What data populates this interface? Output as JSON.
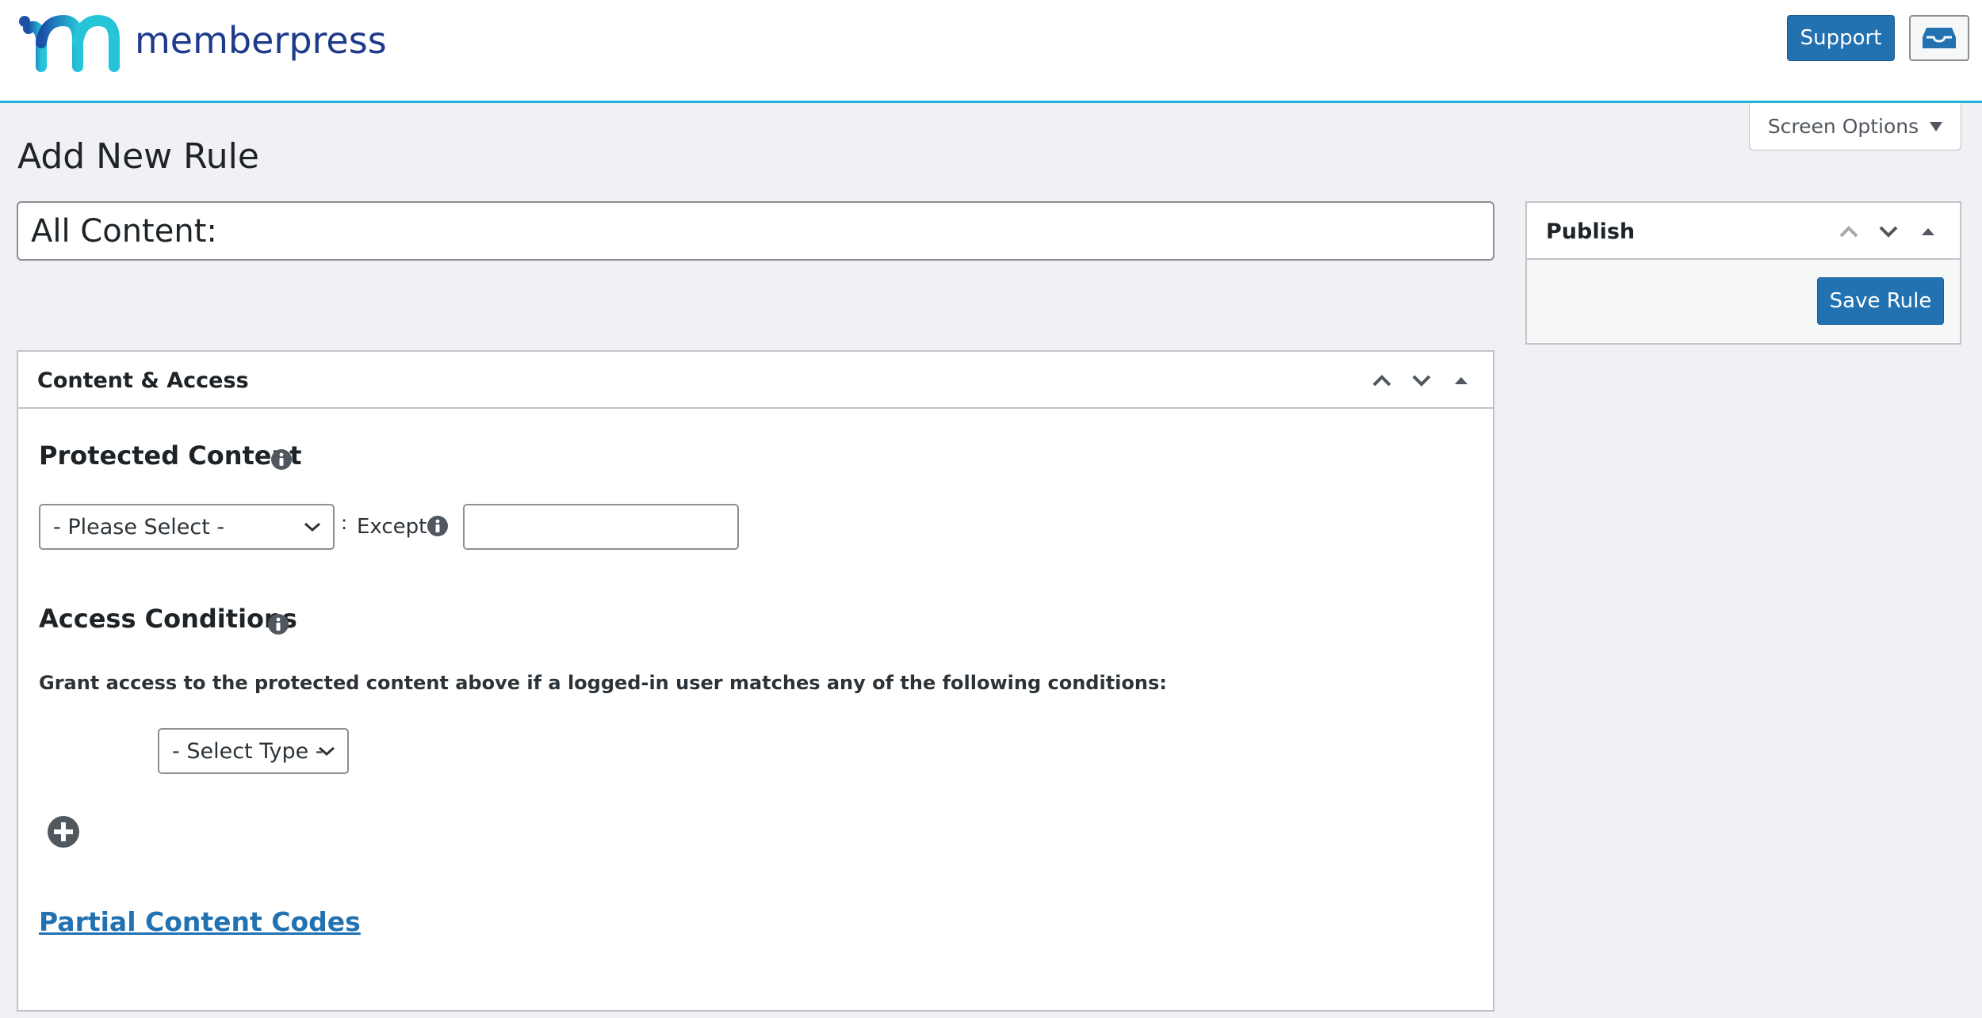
{
  "header": {
    "brand": "memberpress",
    "support_label": "Support"
  },
  "screen_options": {
    "label": "Screen Options"
  },
  "page": {
    "title": "Add New Rule",
    "rule_title_value": "All Content:"
  },
  "publish": {
    "title": "Publish",
    "save_label": "Save Rule"
  },
  "content_access": {
    "title": "Content & Access",
    "protected_content_heading": "Protected Content",
    "protected_select_value": "- Please Select -",
    "colon": ":",
    "except_label": "Except",
    "except_value": "",
    "access_conditions_heading": "Access Conditions",
    "grant_text": "Grant access to the protected content above if a logged-in user matches any of the following conditions:",
    "select_type_value": "- Select Type -",
    "partial_link": "Partial Content Codes"
  },
  "colors": {
    "accent": "#2271b1",
    "header_border": "#1fb6d6",
    "background": "#f0f0f5"
  },
  "icons": [
    "memberpress-logo-icon",
    "inbox-icon",
    "chevron-up-icon",
    "chevron-down-icon",
    "triangle-up-icon",
    "info-icon",
    "plus-circle-icon",
    "select-chevron-icon"
  ]
}
